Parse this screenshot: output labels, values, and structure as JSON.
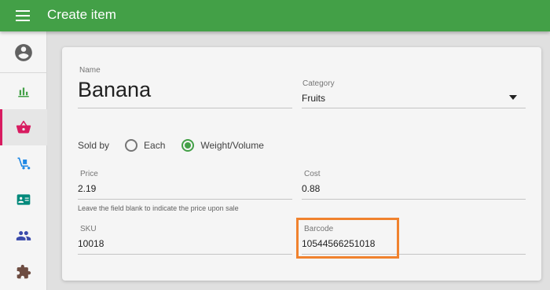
{
  "appbar": {
    "title": "Create item",
    "menu_icon": "hamburger-menu-icon"
  },
  "sidebar": {
    "items": [
      {
        "name": "account",
        "icon": "account-circle-icon",
        "color": "#616161"
      },
      {
        "name": "reports",
        "icon": "bar-chart-icon",
        "color": "#43a047"
      },
      {
        "name": "items",
        "icon": "basket-icon",
        "color": "#d81b60",
        "active": true
      },
      {
        "name": "inventory",
        "icon": "hand-truck-icon",
        "color": "#1e88e5"
      },
      {
        "name": "customers",
        "icon": "contact-card-icon",
        "color": "#00897b"
      },
      {
        "name": "employees",
        "icon": "people-icon",
        "color": "#3949ab"
      },
      {
        "name": "apps",
        "icon": "puzzle-icon",
        "color": "#6d4c41"
      }
    ]
  },
  "form": {
    "name": {
      "label": "Name",
      "value": "Banana"
    },
    "category": {
      "label": "Category",
      "value": "Fruits"
    },
    "sold_by": {
      "label": "Sold by",
      "options": [
        "Each",
        "Weight/Volume"
      ],
      "selected": "Weight/Volume"
    },
    "price": {
      "label": "Price",
      "value": "2.19"
    },
    "cost": {
      "label": "Cost",
      "value": "0.88"
    },
    "price_hint": "Leave the field blank to indicate the price upon sale",
    "sku": {
      "label": "SKU",
      "value": "10018"
    },
    "barcode": {
      "label": "Barcode",
      "value": "10544566251018"
    }
  },
  "colors": {
    "primary": "#43a047",
    "accent": "#d81b60",
    "highlight": "#f0822e"
  }
}
